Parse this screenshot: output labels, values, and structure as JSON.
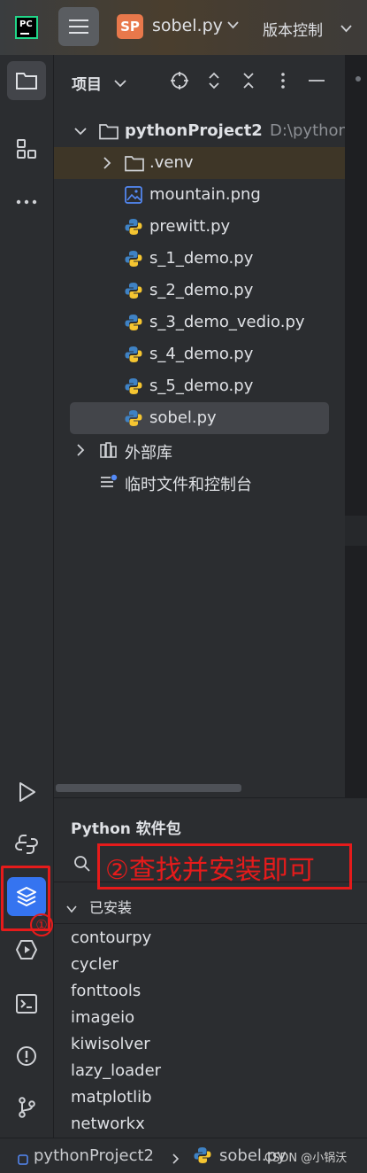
{
  "titlebar": {
    "logo_text": "PC",
    "file_badge": "SP",
    "file_name": "sobel.py",
    "vcs_label": "版本控制"
  },
  "project_panel": {
    "title": "项目",
    "root": {
      "name": "pythonProject2",
      "path": "D:\\python"
    },
    "items": [
      {
        "name": ".venv",
        "type": "folder"
      },
      {
        "name": "mountain.png",
        "type": "image"
      },
      {
        "name": "prewitt.py",
        "type": "python"
      },
      {
        "name": "s_1_demo.py",
        "type": "python"
      },
      {
        "name": "s_2_demo.py",
        "type": "python"
      },
      {
        "name": "s_3_demo_vedio.py",
        "type": "python"
      },
      {
        "name": "s_4_demo.py",
        "type": "python"
      },
      {
        "name": "s_5_demo.py",
        "type": "python"
      },
      {
        "name": "sobel.py",
        "type": "python",
        "selected": true
      }
    ],
    "external_libs": "外部库",
    "scratches": "临时文件和控制台"
  },
  "packages_panel": {
    "title": "Python 软件包",
    "search_annotation": "②查找并安装即可",
    "installed_section": "已安装",
    "packages": [
      "contourpy",
      "cycler",
      "fonttools",
      "imageio",
      "kiwisolver",
      "lazy_loader",
      "matplotlib",
      "networkx"
    ]
  },
  "annotations": {
    "marker_1": "①"
  },
  "statusbar": {
    "project": "pythonProject2",
    "file": "sobel.py"
  },
  "watermark": "CSDN @小锅沃",
  "colors": {
    "annotation_red": "#e61b1b",
    "accent_blue": "#3574f0",
    "file_badge_orange": "#e8784b"
  }
}
